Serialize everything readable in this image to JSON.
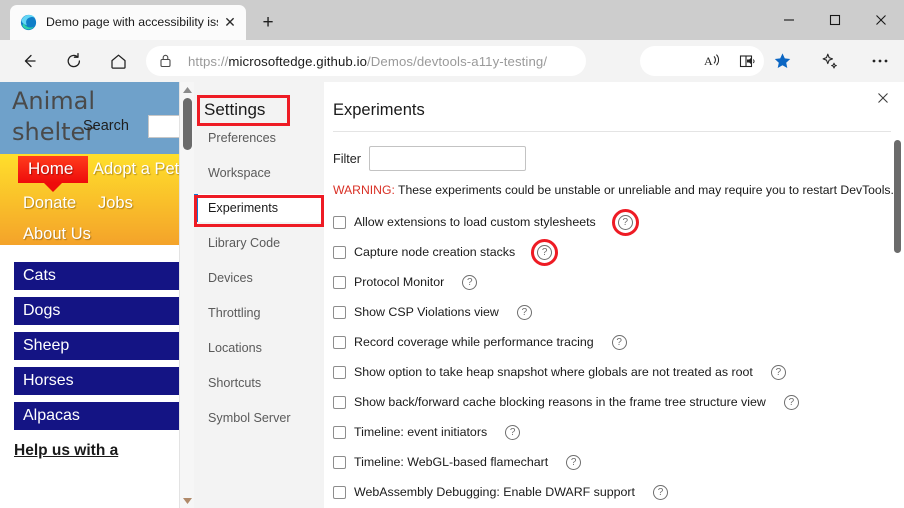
{
  "browser": {
    "tab": {
      "title": "Demo page with accessibility iss",
      "favicon_name": "edge-logo-icon",
      "close_label": "✕"
    },
    "new_tab_label": "+",
    "window_controls": {
      "minimize": "─",
      "maximize": "□",
      "close": "✕"
    },
    "toolbar": {
      "back_label": "←",
      "refresh_label": "⟳",
      "home_label": "⌂",
      "url_prefix": "https://",
      "url_host": "microsoftedge.github.io",
      "url_path": "/Demos/devtools-a11y-testing/",
      "url_full": "https://microsoftedge.github.io/Demos/devtools-a11y-testing/",
      "read_aloud_label": "A",
      "immersive_reader_name": "immersive-reader-icon",
      "favorite_name": "favorite-star-icon",
      "copilot_name": "copilot-sparkle-icon",
      "settings_more_label": "⋯",
      "accent_color": "#0b66c3"
    }
  },
  "webpage": {
    "site_title_line1": "Animal",
    "site_title_line2": "shelter",
    "search_label": "Search",
    "search_value": "",
    "nav": {
      "home": "Home",
      "adopt": "Adopt a Pet",
      "donate": "Donate",
      "jobs": "Jobs",
      "about": "About Us"
    },
    "animals": [
      "Cats",
      "Dogs",
      "Sheep",
      "Horses",
      "Alpacas"
    ],
    "help_text": "Help us with a",
    "colors": {
      "header_bg": "#6fa1ca",
      "nav_top": "#ffdf2b",
      "nav_bottom": "#f4a32a",
      "active_nav": "#ee0b0b",
      "animal_bg": "#141484"
    }
  },
  "devtools": {
    "heading": "Settings",
    "nav_items": [
      "Preferences",
      "Workspace",
      "Experiments",
      "Library Code",
      "Devices",
      "Throttling",
      "Locations",
      "Shortcuts",
      "Symbol Server"
    ],
    "selected_nav": "Experiments",
    "panel_title": "Experiments",
    "close_label": "✕",
    "filter_label": "Filter",
    "filter_value": "",
    "filter_placeholder": "",
    "warning_prefix": "WARNING:",
    "warning_text": " These experiments could be unstable or unreliable and may require you to restart DevTools.",
    "help_glyph": "?",
    "experiments": [
      {
        "label": "Allow extensions to load custom stylesheets",
        "checked": false,
        "highlighted": true
      },
      {
        "label": "Capture node creation stacks",
        "checked": false,
        "highlighted": true
      },
      {
        "label": "Protocol Monitor",
        "checked": false,
        "highlighted": false
      },
      {
        "label": "Show CSP Violations view",
        "checked": false,
        "highlighted": false
      },
      {
        "label": "Record coverage while performance tracing",
        "checked": false,
        "highlighted": false
      },
      {
        "label": "Show option to take heap snapshot where globals are not treated as root",
        "checked": false,
        "highlighted": false
      },
      {
        "label": "Show back/forward cache blocking reasons in the frame tree structure view",
        "checked": false,
        "highlighted": false
      },
      {
        "label": "Timeline: event initiators",
        "checked": false,
        "highlighted": false
      },
      {
        "label": "Timeline: WebGL-based flamechart",
        "checked": false,
        "highlighted": false
      },
      {
        "label": "WebAssembly Debugging: Enable DWARF support",
        "checked": false,
        "highlighted": false
      }
    ],
    "highlight_color": "#ee1b24",
    "selected_accent": "#1376d1",
    "warning_color": "#d93025"
  }
}
